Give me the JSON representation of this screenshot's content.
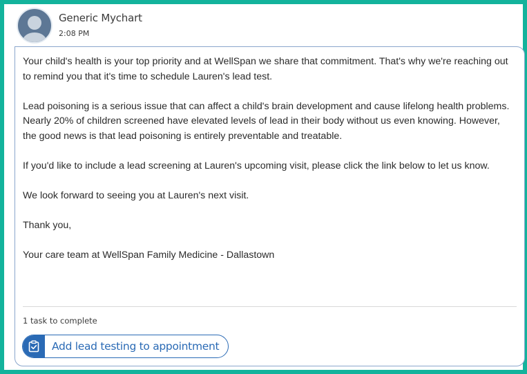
{
  "message": {
    "sender": "Generic Mychart",
    "time": "2:08 PM",
    "paragraphs": [
      "Your child's health is your top priority and at WellSpan we share that commitment. That's why we're reaching out to remind you that it's time to schedule Lauren's lead test.",
      "Lead poisoning is a serious issue that can affect a child's brain development and cause lifelong health problems. Nearly 20% of children screened have elevated levels of lead in their body without us even knowing. However, the good news is that lead poisoning is entirely preventable and treatable.",
      "If you'd like to include a lead screening at Lauren's upcoming visit, please click the link below to let us know.",
      "We look forward to seeing you at Lauren's next visit.",
      "Thank you,",
      "Your care team at WellSpan Family Medicine - Dallastown"
    ]
  },
  "tasks": {
    "count_label": "1 task to complete",
    "items": [
      {
        "label": "Add lead testing to appointment",
        "icon": "clipboard-check-icon"
      }
    ]
  },
  "colors": {
    "frame_border": "#13b39c",
    "bubble_border": "#8aa6cc",
    "accent": "#2a6ab5",
    "avatar_bg": "#5d7795"
  }
}
